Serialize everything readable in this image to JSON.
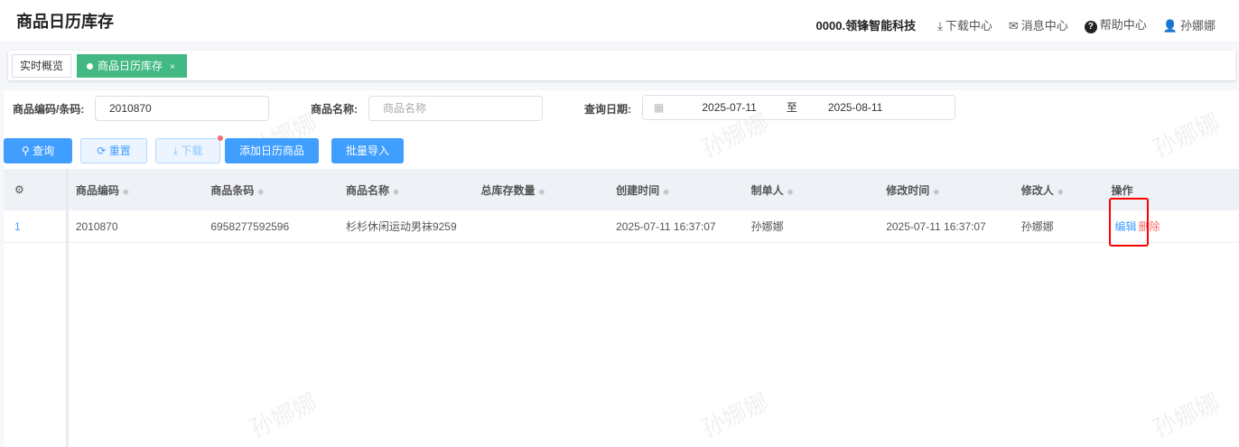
{
  "header": {
    "title": "商品日历库存",
    "company": "0000.领锋智能科技",
    "download_center": "下载中心",
    "message_center": "消息中心",
    "help_center": "帮助中心",
    "user": "孙娜娜"
  },
  "tabs": [
    {
      "label": "实时概览"
    },
    {
      "label": "商品日历库存",
      "close": "×"
    }
  ],
  "filters": {
    "code_label": "商品编码/条码:",
    "code_value": "2010870",
    "name_label": "商品名称:",
    "name_placeholder": "商品名称",
    "date_label": "查询日期:",
    "date_from": "2025-07-11",
    "date_sep": "至",
    "date_to": "2025-08-11"
  },
  "buttons": {
    "query": "查询",
    "reset": "重置",
    "download": "下载",
    "add": "添加日历商品",
    "import": "批量导入"
  },
  "table": {
    "headers": [
      "商品编码",
      "商品条码",
      "商品名称",
      "总库存数量",
      "创建时间",
      "制单人",
      "修改时间",
      "修改人",
      "操作"
    ],
    "rows": [
      {
        "index": "1",
        "cells": [
          "2010870",
          "6958277592596",
          "杉杉休闲运动男袜9259",
          "",
          "2025-07-11 16:37:07",
          "孙娜娜",
          "2025-07-11 16:37:07",
          "孙娜娜"
        ],
        "edit": "编辑",
        "delete": "删除"
      }
    ]
  },
  "watermark": "孙娜娜"
}
